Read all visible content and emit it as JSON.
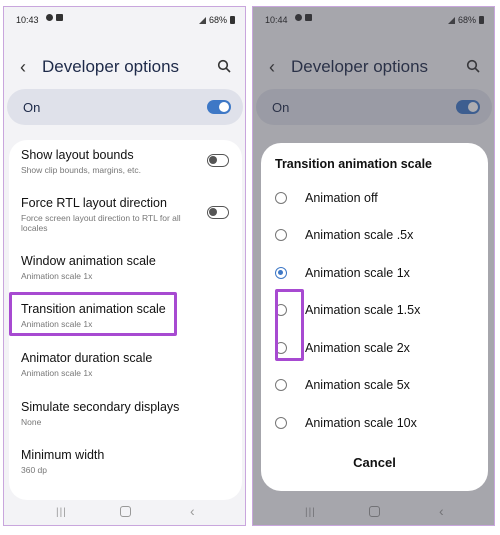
{
  "left": {
    "status": {
      "time": "10:43",
      "battery": "68%"
    },
    "header": {
      "title": "Developer options"
    },
    "master_switch": {
      "label": "On",
      "state": "on"
    },
    "items": [
      {
        "title": "Show layout bounds",
        "subtitle": "Show clip bounds, margins, etc.",
        "toggle": "off"
      },
      {
        "title": "Force RTL layout direction",
        "subtitle": "Force screen layout direction to RTL for all locales",
        "toggle": "off"
      },
      {
        "title": "Window animation scale",
        "subtitle": "Animation scale 1x"
      },
      {
        "title": "Transition animation scale",
        "subtitle": "Animation scale 1x"
      },
      {
        "title": "Animator duration scale",
        "subtitle": "Animation scale 1x"
      },
      {
        "title": "Simulate secondary displays",
        "subtitle": "None"
      },
      {
        "title": "Minimum width",
        "subtitle": "360 dp"
      }
    ]
  },
  "right": {
    "status": {
      "time": "10:44",
      "battery": "68%"
    },
    "header": {
      "title": "Developer options"
    },
    "master_switch": {
      "label": "On",
      "state": "on"
    },
    "dialog": {
      "title": "Transition animation scale",
      "options": [
        {
          "label": "Animation off",
          "selected": false
        },
        {
          "label": "Animation scale .5x",
          "selected": false
        },
        {
          "label": "Animation scale 1x",
          "selected": true
        },
        {
          "label": "Animation scale 1.5x",
          "selected": false
        },
        {
          "label": "Animation scale 2x",
          "selected": false
        },
        {
          "label": "Animation scale 5x",
          "selected": false
        },
        {
          "label": "Animation scale 10x",
          "selected": false
        }
      ],
      "cancel": "Cancel"
    }
  },
  "colors": {
    "accent": "#3e78c6",
    "highlight": "#a74ad1",
    "title": "#1e2a49"
  }
}
